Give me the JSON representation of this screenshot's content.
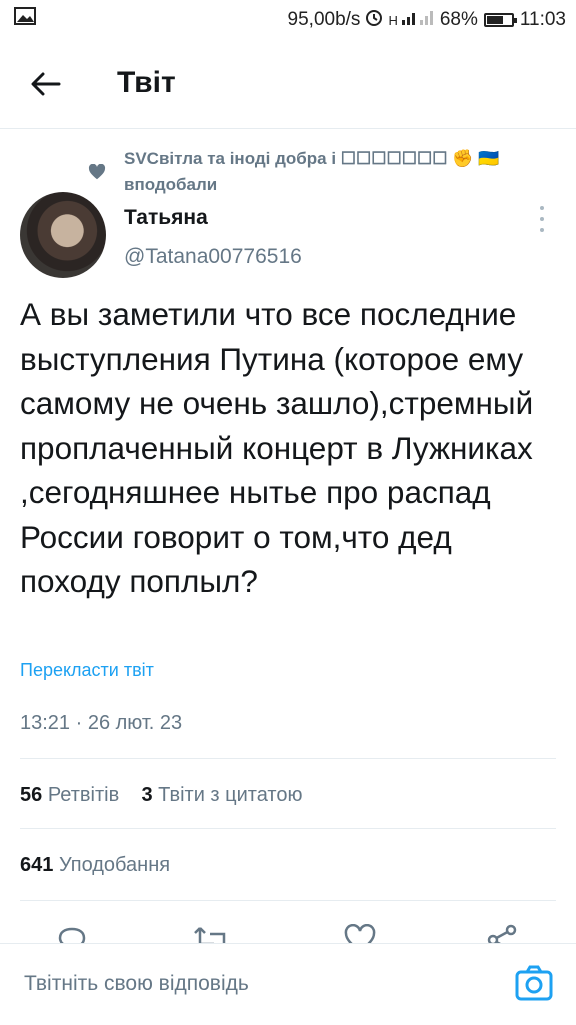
{
  "status_bar": {
    "speed": "95,00b/s",
    "network": "H",
    "battery": "68%",
    "battery_level": 0.68,
    "time": "11:03"
  },
  "header": {
    "back_icon": "arrow-left-icon",
    "title": "Твіт"
  },
  "liked_by": {
    "icon": "heart-icon",
    "text": "SVСвітла та іноді добра і ☐☐☐☐☐☐☐ ✊ 🇺🇦 вподобали"
  },
  "tweet": {
    "author_name": "Татьяна",
    "author_handle": "@Tatana00776516",
    "text": "А вы заметили что все последние выступления Путина (которое ему самому не очень зашло),стремный проплаченный концерт в Лужниках ,сегодняшнее нытье про распад России говорит о том,что дед походу поплыл?",
    "translate_label": "Перекласти твіт",
    "timestamp": "13:21 · 26 лют. 23"
  },
  "stats": {
    "retweets_count": "56",
    "retweets_label": "Ретвітів",
    "quotes_count": "3",
    "quotes_label": "Твіти з цитатою",
    "likes_count": "641",
    "likes_label": "Уподобання"
  },
  "actions": [
    "reply-icon",
    "retweet-icon",
    "like-icon",
    "share-icon"
  ],
  "reply_bar": {
    "placeholder": "Твітніть свою відповідь",
    "camera_icon": "camera-icon"
  },
  "colors": {
    "accent": "#1da1f2",
    "secondary_text": "#657786",
    "divider": "#e6ecf0"
  }
}
